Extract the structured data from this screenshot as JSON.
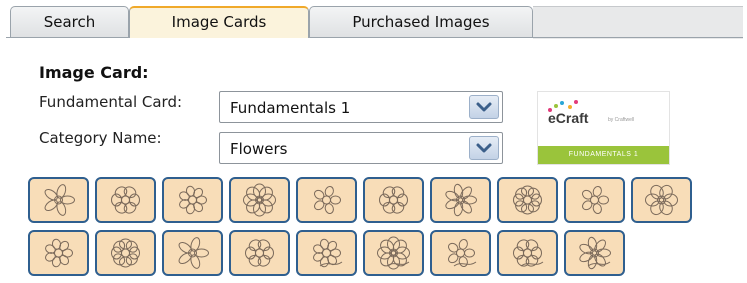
{
  "tabs": [
    {
      "label": "Search"
    },
    {
      "label": "Image Cards",
      "active": true
    },
    {
      "label": "Purchased Images"
    }
  ],
  "section_title": "Image Card:",
  "fields": {
    "fundamental_label": "Fundamental Card:",
    "fundamental_value": "Fundamentals 1",
    "category_label": "Category Name:",
    "category_value": "Flowers"
  },
  "logo": {
    "brand": "eCraft",
    "small": "by Craftwell",
    "banner": "FUNDAMENTALS 1"
  },
  "cards": [
    {
      "icon": "flower-outline-icon"
    },
    {
      "icon": "flower-outline-icon"
    },
    {
      "icon": "flower-outline-icon"
    },
    {
      "icon": "flower-outline-icon"
    },
    {
      "icon": "flower-outline-icon"
    },
    {
      "icon": "flower-outline-icon"
    },
    {
      "icon": "flower-outline-icon"
    },
    {
      "icon": "flower-outline-icon"
    },
    {
      "icon": "flower-outline-icon"
    },
    {
      "icon": "flower-outline-icon"
    },
    {
      "icon": "flower-outline-icon"
    },
    {
      "icon": "flower-outline-icon"
    },
    {
      "icon": "flower-outline-icon"
    },
    {
      "icon": "flower-outline-icon"
    },
    {
      "icon": "flower-outline-icon"
    },
    {
      "icon": "flower-outline-icon"
    },
    {
      "icon": "flower-outline-icon"
    },
    {
      "icon": "flower-outline-icon"
    },
    {
      "icon": "flower-outline-icon"
    }
  ],
  "colors": {
    "active_tab_accent": "#f0a92a",
    "card_fill": "#f8ddb8",
    "card_border": "#2f5f8f",
    "logo_banner": "#9ac43b"
  }
}
